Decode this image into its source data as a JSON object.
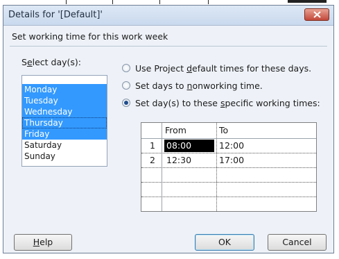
{
  "window": {
    "title": "Details for '[Default]'"
  },
  "section_header": "Set working time for this work week",
  "select_days": {
    "label_prefix": "S",
    "label_accel": "e",
    "label_suffix": "lect day(s):",
    "days": [
      "Monday",
      "Tuesday",
      "Wednesday",
      "Thursday",
      "Friday",
      "Saturday",
      "Sunday"
    ],
    "selected": [
      "Monday",
      "Tuesday",
      "Wednesday",
      "Thursday",
      "Friday"
    ],
    "focused": "Thursday"
  },
  "options": {
    "opt1": {
      "pre": "Use Project ",
      "accel": "d",
      "post": "efault times for these days."
    },
    "opt2": {
      "pre": "Set days to ",
      "accel": "n",
      "post": "onworking time."
    },
    "opt3": {
      "pre": "Set day(s) to these ",
      "accel": "s",
      "post": "pecific working times:"
    },
    "selected": "opt3"
  },
  "times_table": {
    "columns": [
      "From",
      "To"
    ],
    "rows": [
      {
        "num": "1",
        "from": "08:00",
        "to": "12:00"
      },
      {
        "num": "2",
        "from": "12:30",
        "to": "17:00"
      }
    ],
    "active_cell": "1.from"
  },
  "buttons": {
    "help_accel": "H",
    "help_rest": "elp",
    "ok": "OK",
    "cancel": "Cancel"
  },
  "colors": {
    "selection": "#3399ff",
    "dialog_bg": "#eef2f8",
    "close_button": "#c2483a"
  }
}
